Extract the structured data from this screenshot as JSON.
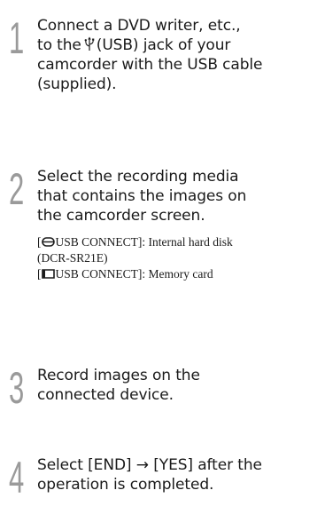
{
  "steps": [
    {
      "number": "1",
      "lines": [
        "Connect a DVD writer, etc.,",
        "to the",
        "(USB) jack of your",
        "camcorder with the USB cable",
        "(supplied)."
      ],
      "icon": "usb-icon"
    },
    {
      "number": "2",
      "lines": [
        "Select the recording media",
        "that contains the images on",
        "the camcorder screen."
      ],
      "notes": [
        {
          "icon": "hard-disk-icon",
          "lines": [
            "USB CONNECT]: Internal hard disk",
            "(DCR-SR21E)"
          ]
        },
        {
          "icon": "memory-card-icon",
          "lines": [
            "USB CONNECT]: Memory card"
          ]
        }
      ]
    },
    {
      "number": "3",
      "lines": [
        "Record images on the",
        "connected device."
      ]
    },
    {
      "number": "4",
      "lines": [
        "Select [END]",
        "[YES] after the",
        "operation is completed."
      ],
      "arrow": "→"
    }
  ]
}
